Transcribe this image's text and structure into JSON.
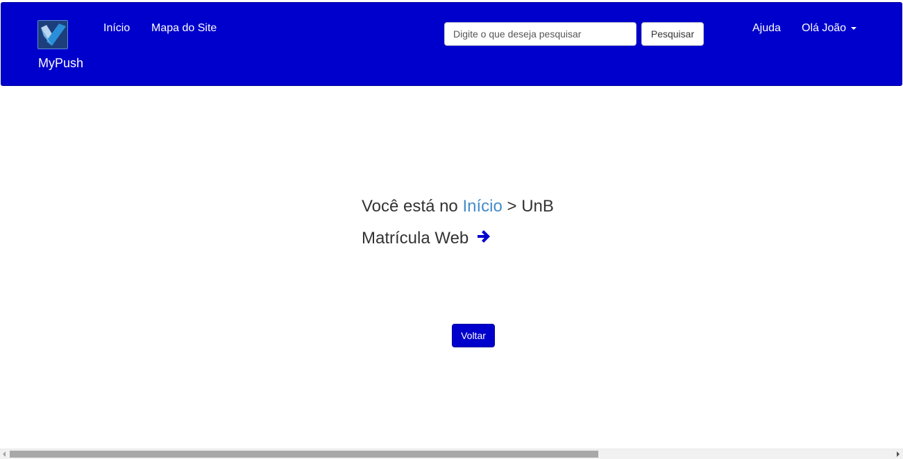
{
  "header": {
    "brand_name": "MyPush",
    "logo_icon": "checkmark-logo-icon",
    "nav": {
      "home": "Início",
      "sitemap": "Mapa do Site"
    },
    "search": {
      "placeholder": "Digite o que deseja pesquisar",
      "value": "",
      "button_label": "Pesquisar"
    },
    "help": "Ajuda",
    "user_greeting": "Olá João",
    "user_menu_icon": "caret-down-icon"
  },
  "main": {
    "breadcrumb": {
      "prefix": "Você está no",
      "home_link": "Início",
      "separator": ">",
      "current": "UnB"
    },
    "item": {
      "label": "Matrícula Web",
      "icon": "arrow-right-icon"
    },
    "back_label": "Voltar"
  },
  "colors": {
    "navbar": "#0000cc",
    "link": "#428bca",
    "text": "#333333",
    "arrow": "#0000cc"
  }
}
